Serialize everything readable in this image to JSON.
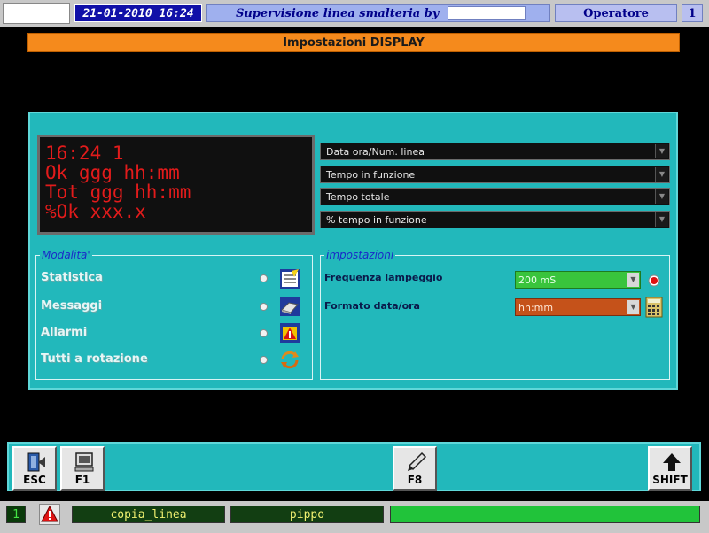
{
  "topbar": {
    "datetime": "21-01-2010 16:24",
    "title": "Supervisione linea smalteria by",
    "operator": "Operatore",
    "operator_num": "1"
  },
  "header": {
    "title": "Impostazioni DISPLAY"
  },
  "led_display": {
    "lines": [
      "16:24 1",
      "Ok ggg hh:mm",
      "Tot ggg hh:mm",
      "%Ok xxx.x"
    ]
  },
  "line_selects": [
    {
      "value": "Data ora/Num. linea"
    },
    {
      "value": "Tempo in funzione"
    },
    {
      "value": "Tempo totale"
    },
    {
      "value": "% tempo in funzione"
    }
  ],
  "modalita": {
    "legend": "Modalita'",
    "items": [
      {
        "label": "Statistica",
        "icon": "statistics-icon",
        "selected": false
      },
      {
        "label": "Messaggi",
        "icon": "messages-icon",
        "selected": false
      },
      {
        "label": "Allarmi",
        "icon": "alarms-icon",
        "selected": false
      },
      {
        "label": "Tutti a rotazione",
        "icon": "rotation-icon",
        "selected": false
      }
    ]
  },
  "impostazioni": {
    "legend": "impostazioni",
    "frequency": {
      "label": "Frequenza lampeggio",
      "value": "200 mS"
    },
    "format": {
      "label": "Formato data/ora",
      "value": "hh:mm"
    }
  },
  "fkeys": {
    "esc": "ESC",
    "f1": "F1",
    "f8": "F8",
    "shift": "SHIFT"
  },
  "statusbar": {
    "num": "1",
    "field1": "copia_linea",
    "field2": "pippo"
  },
  "colors": {
    "panel": "#22b8bb",
    "header": "#f58a1c",
    "led": "#e21b1b",
    "freq_select": "#39c43c",
    "format_select": "#c5521a"
  }
}
